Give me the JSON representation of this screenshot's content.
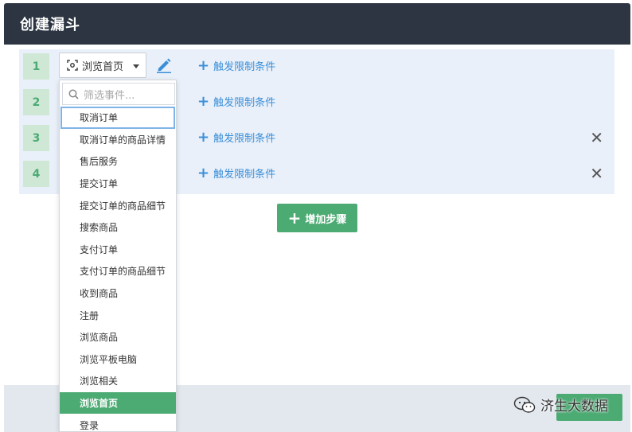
{
  "dialog": {
    "title": "创建漏斗"
  },
  "steps": [
    {
      "number": "1",
      "event": "浏览首页",
      "add_condition": "触发限制条件",
      "removable": false
    },
    {
      "number": "2",
      "event": "",
      "add_condition": "触发限制条件",
      "removable": false
    },
    {
      "number": "3",
      "event": "",
      "add_condition": "触发限制条件",
      "removable": true
    },
    {
      "number": "4",
      "event": "",
      "add_condition": "触发限制条件",
      "removable": true
    }
  ],
  "add_step_label": "增加步骤",
  "dropdown": {
    "search_placeholder": "筛选事件...",
    "items": [
      "取消订单",
      "取消订单的商品详情",
      "售后服务",
      "提交订单",
      "提交订单的商品细节",
      "搜索商品",
      "支付订单",
      "支付订单的商品细节",
      "收到商品",
      "注册",
      "浏览商品",
      "浏览平板电脑",
      "浏览相关",
      "浏览首页",
      "登录"
    ],
    "highlighted_index": 0,
    "selected_index": 13
  },
  "watermark": "济生大数据",
  "colors": {
    "header_bg": "#2d3542",
    "accent_green": "#4caa73",
    "link_blue": "#3b8fd8",
    "panel_bg": "#eaf0f9"
  }
}
